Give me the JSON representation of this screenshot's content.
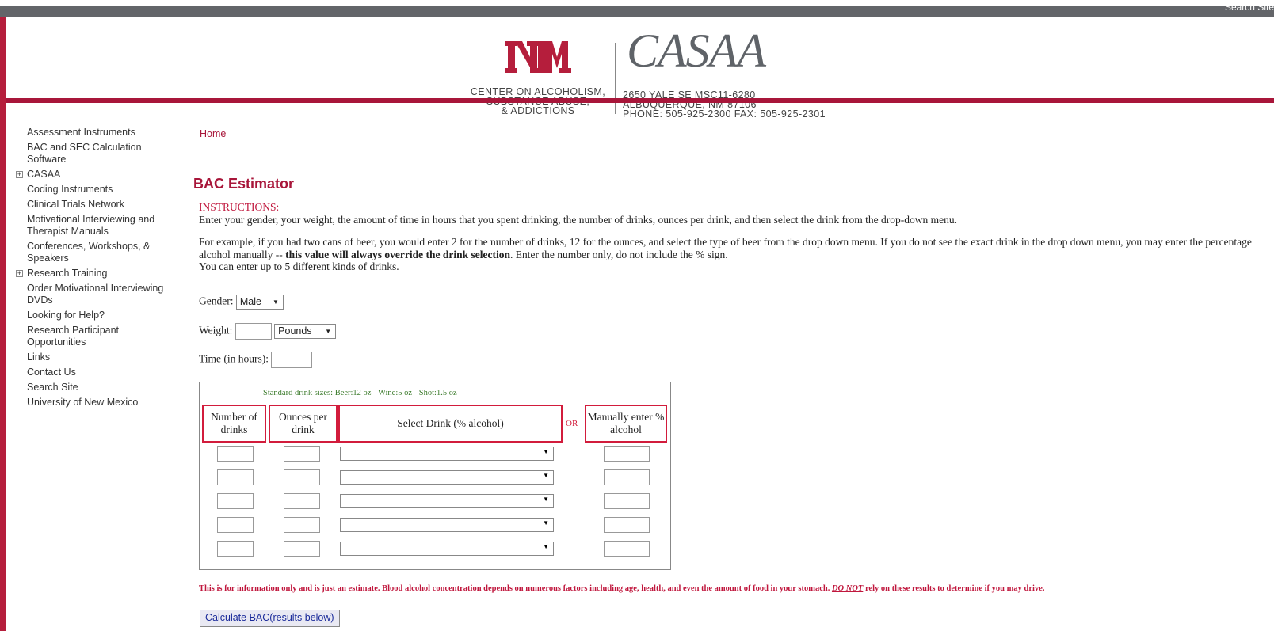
{
  "topbar": {
    "search_link": "Search Site"
  },
  "header": {
    "logo_nm": "NM",
    "logo_casaa": "CASAA",
    "center_name": [
      "CENTER ON ALCOHOLISM,",
      "SUBSTANCE ABUSE,",
      "& ADDICTIONS"
    ],
    "address": [
      "2650 YALE SE MSC11-6280",
      "ALBUQUERQUE, NM 87106",
      "PHONE: 505-925-2300  FAX: 505-925-2301"
    ]
  },
  "sidebar": {
    "items": [
      {
        "label": "Assessment Instruments",
        "expandable": false
      },
      {
        "label": "BAC and SEC Calculation Software",
        "expandable": false
      },
      {
        "label": "CASAA",
        "expandable": true
      },
      {
        "label": "Coding Instruments",
        "expandable": false
      },
      {
        "label": "Clinical Trials Network",
        "expandable": false
      },
      {
        "label": "Motivational Interviewing and Therapist Manuals",
        "expandable": false
      },
      {
        "label": "Conferences, Workshops, & Speakers",
        "expandable": false
      },
      {
        "label": "Research Training",
        "expandable": true
      },
      {
        "label": "Order Motivational Interviewing DVDs",
        "expandable": false
      },
      {
        "label": "Looking for Help?",
        "expandable": false
      },
      {
        "label": "Research Participant Opportunities",
        "expandable": false
      },
      {
        "label": "Links",
        "expandable": false
      },
      {
        "label": "Contact Us",
        "expandable": false
      },
      {
        "label": "Search Site",
        "expandable": false
      },
      {
        "label": "University of New Mexico",
        "expandable": false
      }
    ],
    "expand_glyph": "+"
  },
  "breadcrumb": "Home",
  "page_title": "BAC Estimator",
  "instructions": {
    "title": "INSTRUCTIONS:",
    "line1": "Enter your gender, your weight, the amount of time in hours that you spent drinking, the number of drinks, ounces per drink, and then select the drink from the drop-down menu.",
    "line2a": "For example, if you had two cans of beer, you would enter 2 for the number of drinks, 12 for the ounces, and select the type of beer from the drop down menu. If you do not see the exact drink in the drop down menu, you may enter the percentage alcohol manually -- ",
    "line2b": "this value will always override the drink selection",
    "line2c": ". Enter the number only, do not include the % sign.",
    "line3": "You can enter up to 5 different kinds of drinks."
  },
  "form": {
    "gender_label": "Gender:",
    "gender_value": "Male",
    "weight_label": "Weight:",
    "weight_value": "",
    "weight_unit": "Pounds",
    "time_label": "Time (in hours):",
    "time_value": ""
  },
  "calc_table": {
    "standard_sizes": "Standard drink sizes: Beer:12 oz - Wine:5 oz - Shot:1.5 oz",
    "headers": {
      "num_drinks": "Number of drinks",
      "ounces": "Ounces per drink",
      "select": "Select Drink (% alcohol)",
      "or": "OR",
      "manual": "Manually enter % alcohol"
    },
    "row_count": 5
  },
  "disclaimer": {
    "a": "This is for information only and is just an estimate. Blood alcohol concentration depends on numerous factors including age, health, and even the amount of food in your stomach. ",
    "donot": "DO NOT",
    "b": " rely on these results to determine if you may drive."
  },
  "calc_button": "Calculate BAC(results below)",
  "colors": {
    "brand_red": "#a8163a",
    "accent_red": "#d21c3c",
    "topbar_gray": "#636569",
    "green_note": "#3a7a2a"
  }
}
